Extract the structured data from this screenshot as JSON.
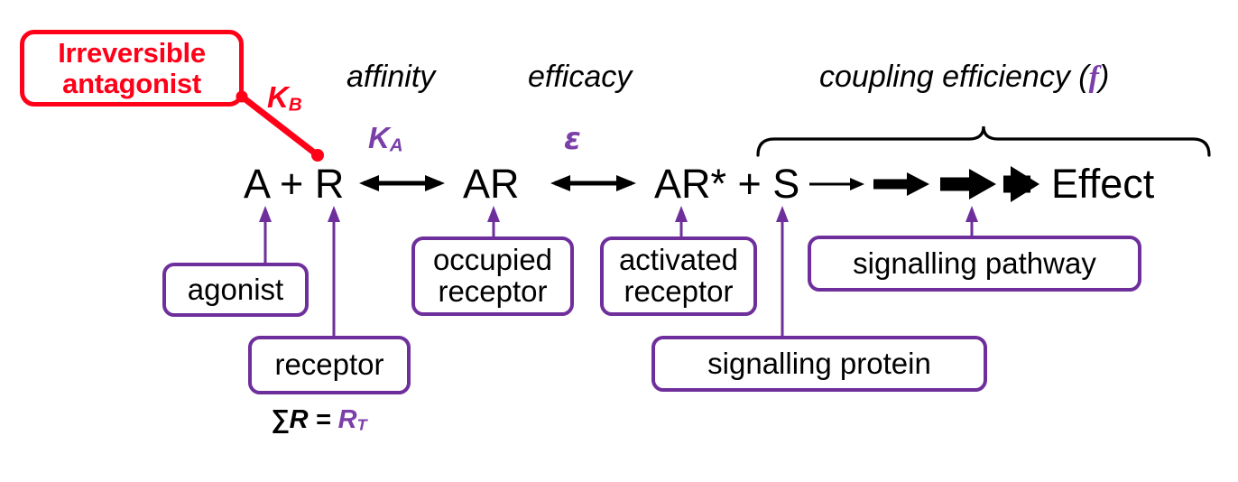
{
  "diagram": {
    "title_elements": {
      "antagonist_box": {
        "line1": "Irreversible",
        "line2": "antagonist",
        "color": "#FF0018"
      }
    },
    "descriptors": [
      {
        "name": "affinity",
        "text": "affinity"
      },
      {
        "name": "efficacy",
        "text": "efficacy"
      },
      {
        "name": "coupling",
        "text_before": "coupling efficiency (",
        "symbol": "f",
        "text_after": ")"
      }
    ],
    "constants": [
      {
        "name": "KB",
        "base": "K",
        "sub": "B",
        "color": "#FF0018"
      },
      {
        "name": "KA",
        "base": "K",
        "sub": "A",
        "color": "#7A3FA8"
      },
      {
        "name": "epsilon",
        "symbol": "ε",
        "color": "#7A3FA8"
      }
    ],
    "equation": {
      "terms": [
        {
          "name": "term-a-plus-r",
          "text": "A + R"
        },
        {
          "name": "term-ar",
          "text": "AR"
        },
        {
          "name": "term-ar-star-plus-s",
          "text": "AR* + S"
        },
        {
          "name": "term-effect",
          "text": "Effect"
        }
      ]
    },
    "rt_formula": {
      "prefix": "∑R = ",
      "symbol": "R",
      "sub": "T",
      "symbol_color": "#7A3FA8"
    },
    "callouts": [
      {
        "name": "agonist",
        "lines": [
          "agonist"
        ]
      },
      {
        "name": "receptor",
        "lines": [
          "receptor"
        ]
      },
      {
        "name": "occupied-receptor",
        "lines": [
          "occupied",
          "receptor"
        ]
      },
      {
        "name": "activated-receptor",
        "lines": [
          "activated",
          "receptor"
        ]
      },
      {
        "name": "signalling-pathway",
        "lines": [
          "signalling pathway"
        ]
      },
      {
        "name": "signalling-protein",
        "lines": [
          "signalling protein"
        ]
      }
    ],
    "colors": {
      "purple": "#6E2F9C",
      "purple_text": "#7A3FA8",
      "red": "#FF0018",
      "black": "#000000",
      "background": "#FFFFFF"
    }
  }
}
